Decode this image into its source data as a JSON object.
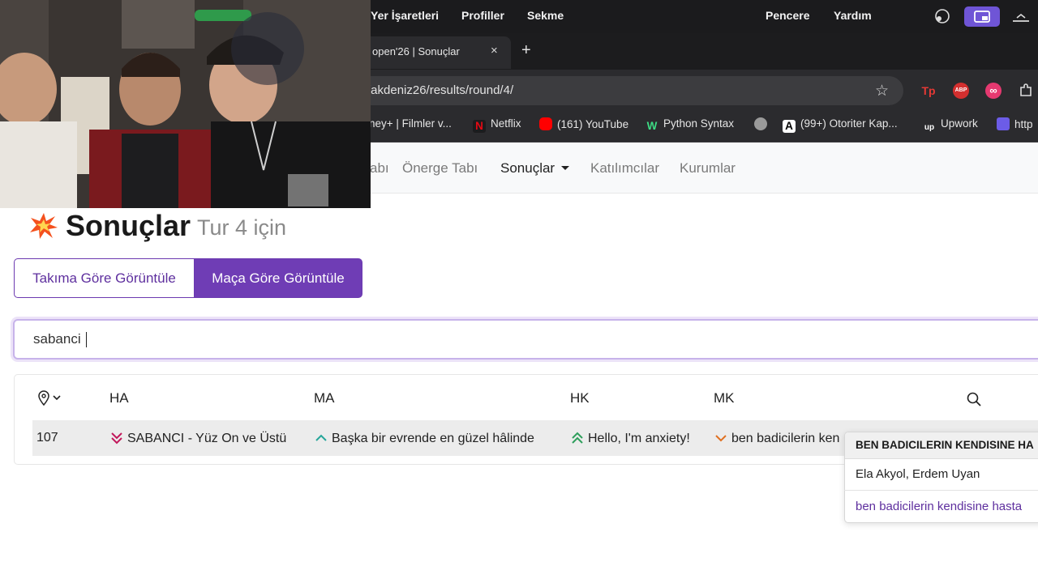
{
  "menubar": {
    "items": [
      "Yer İşaretleri",
      "Profiller",
      "Sekme",
      "Pencere",
      "Yardım"
    ]
  },
  "browser": {
    "tab_title": "open'26 | Sonuçlar",
    "tab_close": "×",
    "new_tab": "+",
    "url": "/akdeniz26/results/round/4/",
    "bookmarks": [
      "ney+ | Filmler v...",
      "Netflix",
      "(161) YouTube",
      "Python Syntax",
      "(99+) Otoriter Kap...",
      "Upwork",
      "http"
    ],
    "extensions": [
      "Tp",
      "ABP",
      "∞"
    ]
  },
  "nav": {
    "items": [
      "abı",
      "Önerge Tabı",
      "Sonuçlar",
      "Katılımcılar",
      "Kurumlar"
    ],
    "active": "Sonuçlar"
  },
  "page": {
    "title": "Sonuçlar",
    "subtitle": "Tur 4 için",
    "toggle": {
      "team_label": "Takıma Göre Görüntüle",
      "match_label": "Maça Göre Görüntüle"
    },
    "search_value": "sabanci"
  },
  "table": {
    "headers": [
      "HA",
      "MA",
      "HK",
      "MK"
    ],
    "rows": [
      {
        "room": "107",
        "ha": "SABANCI - Yüz On ve Üstü",
        "ma": "Başka bir evrende en güzel hâlinde",
        "hk": "Hello, I'm anxiety!",
        "mk": "ben badicilerin ken"
      }
    ]
  },
  "popover": {
    "title": "BEN BADICILERIN KENDISINE HA",
    "members": "Ela Akyol, Erdem Uyan",
    "link": "ben badicilerin kendisine hasta"
  },
  "colors": {
    "accent": "#6f3db5",
    "down_double": "#c2185b",
    "up_single": "#26a69a",
    "up_double": "#2e9e5b",
    "down_single": "#e07020"
  }
}
